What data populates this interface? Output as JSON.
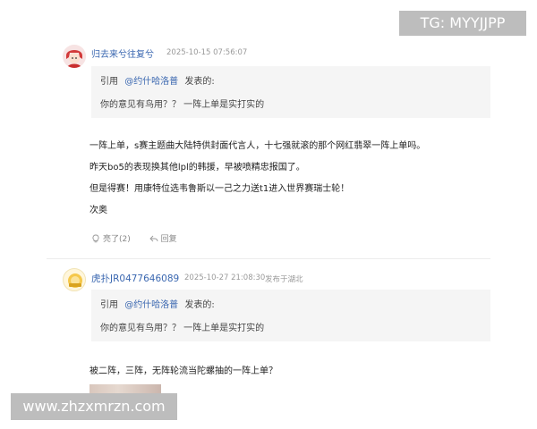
{
  "watermarks": {
    "telegram": "TG: MYYJJPP",
    "site": "www.zhzxmrzn.com"
  },
  "posts": [
    {
      "author": "归去来兮往复兮",
      "time": "2025-10-15 07:56:07",
      "quote": {
        "label": "引用",
        "name": "@约什哈洛普",
        "suffix": "发表的:",
        "text": "你的意见有鸟用？？ 一阵上单是实打实的"
      },
      "lines": [
        "一阵上单，s赛主题曲大陆特供封面代言人，十七强就滚的那个网红翡翠一阵上单吗。",
        "昨天bo5的表现换其他lpl的韩援，早被喷精忠报国了。",
        "但是得赛！用康特位选韦鲁斯以一己之力送t1进入世界赛瑞士轮！",
        "次奥"
      ],
      "like_label": "亮了(2)",
      "reply_label": "回复"
    },
    {
      "author": "虎扑JR0477646089",
      "time": "2025-10-27 21:08:30",
      "location": "发布于湖北",
      "quote": {
        "label": "引用",
        "name": "@约什哈洛普",
        "suffix": "发表的:",
        "text": "你的意见有鸟用？？ 一阵上单是实打实的"
      },
      "lines": [
        "被二阵，三阵，无阵轮流当陀螺抽的一阵上单？"
      ]
    }
  ]
}
